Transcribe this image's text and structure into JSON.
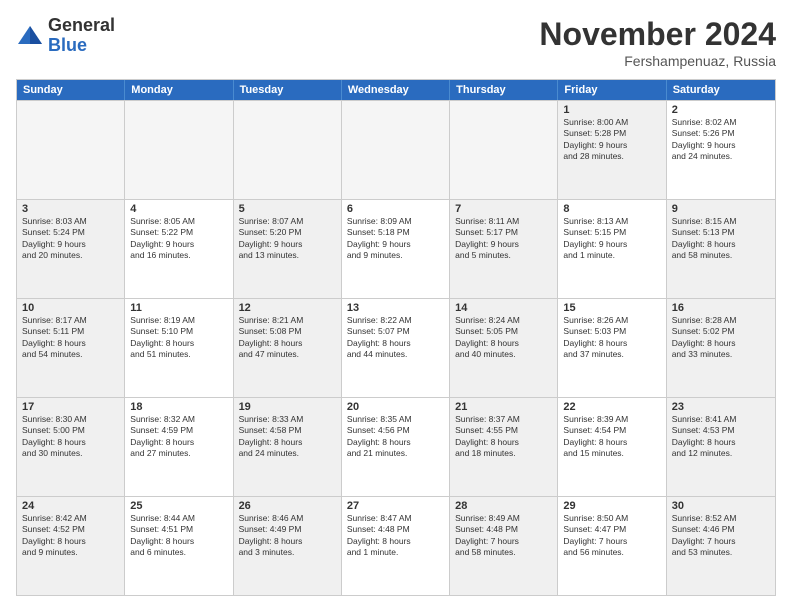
{
  "logo": {
    "general": "General",
    "blue": "Blue"
  },
  "title": "November 2024",
  "location": "Fershampenuaz, Russia",
  "header_days": [
    "Sunday",
    "Monday",
    "Tuesday",
    "Wednesday",
    "Thursday",
    "Friday",
    "Saturday"
  ],
  "rows": [
    [
      {
        "day": "",
        "info": "",
        "empty": true
      },
      {
        "day": "",
        "info": "",
        "empty": true
      },
      {
        "day": "",
        "info": "",
        "empty": true
      },
      {
        "day": "",
        "info": "",
        "empty": true
      },
      {
        "day": "",
        "info": "",
        "empty": true
      },
      {
        "day": "1",
        "info": "Sunrise: 8:00 AM\nSunset: 5:28 PM\nDaylight: 9 hours\nand 28 minutes.",
        "shaded": true
      },
      {
        "day": "2",
        "info": "Sunrise: 8:02 AM\nSunset: 5:26 PM\nDaylight: 9 hours\nand 24 minutes.",
        "shaded": false
      }
    ],
    [
      {
        "day": "3",
        "info": "Sunrise: 8:03 AM\nSunset: 5:24 PM\nDaylight: 9 hours\nand 20 minutes.",
        "shaded": true
      },
      {
        "day": "4",
        "info": "Sunrise: 8:05 AM\nSunset: 5:22 PM\nDaylight: 9 hours\nand 16 minutes.",
        "shaded": false
      },
      {
        "day": "5",
        "info": "Sunrise: 8:07 AM\nSunset: 5:20 PM\nDaylight: 9 hours\nand 13 minutes.",
        "shaded": true
      },
      {
        "day": "6",
        "info": "Sunrise: 8:09 AM\nSunset: 5:18 PM\nDaylight: 9 hours\nand 9 minutes.",
        "shaded": false
      },
      {
        "day": "7",
        "info": "Sunrise: 8:11 AM\nSunset: 5:17 PM\nDaylight: 9 hours\nand 5 minutes.",
        "shaded": true
      },
      {
        "day": "8",
        "info": "Sunrise: 8:13 AM\nSunset: 5:15 PM\nDaylight: 9 hours\nand 1 minute.",
        "shaded": false
      },
      {
        "day": "9",
        "info": "Sunrise: 8:15 AM\nSunset: 5:13 PM\nDaylight: 8 hours\nand 58 minutes.",
        "shaded": true
      }
    ],
    [
      {
        "day": "10",
        "info": "Sunrise: 8:17 AM\nSunset: 5:11 PM\nDaylight: 8 hours\nand 54 minutes.",
        "shaded": true
      },
      {
        "day": "11",
        "info": "Sunrise: 8:19 AM\nSunset: 5:10 PM\nDaylight: 8 hours\nand 51 minutes.",
        "shaded": false
      },
      {
        "day": "12",
        "info": "Sunrise: 8:21 AM\nSunset: 5:08 PM\nDaylight: 8 hours\nand 47 minutes.",
        "shaded": true
      },
      {
        "day": "13",
        "info": "Sunrise: 8:22 AM\nSunset: 5:07 PM\nDaylight: 8 hours\nand 44 minutes.",
        "shaded": false
      },
      {
        "day": "14",
        "info": "Sunrise: 8:24 AM\nSunset: 5:05 PM\nDaylight: 8 hours\nand 40 minutes.",
        "shaded": true
      },
      {
        "day": "15",
        "info": "Sunrise: 8:26 AM\nSunset: 5:03 PM\nDaylight: 8 hours\nand 37 minutes.",
        "shaded": false
      },
      {
        "day": "16",
        "info": "Sunrise: 8:28 AM\nSunset: 5:02 PM\nDaylight: 8 hours\nand 33 minutes.",
        "shaded": true
      }
    ],
    [
      {
        "day": "17",
        "info": "Sunrise: 8:30 AM\nSunset: 5:00 PM\nDaylight: 8 hours\nand 30 minutes.",
        "shaded": true
      },
      {
        "day": "18",
        "info": "Sunrise: 8:32 AM\nSunset: 4:59 PM\nDaylight: 8 hours\nand 27 minutes.",
        "shaded": false
      },
      {
        "day": "19",
        "info": "Sunrise: 8:33 AM\nSunset: 4:58 PM\nDaylight: 8 hours\nand 24 minutes.",
        "shaded": true
      },
      {
        "day": "20",
        "info": "Sunrise: 8:35 AM\nSunset: 4:56 PM\nDaylight: 8 hours\nand 21 minutes.",
        "shaded": false
      },
      {
        "day": "21",
        "info": "Sunrise: 8:37 AM\nSunset: 4:55 PM\nDaylight: 8 hours\nand 18 minutes.",
        "shaded": true
      },
      {
        "day": "22",
        "info": "Sunrise: 8:39 AM\nSunset: 4:54 PM\nDaylight: 8 hours\nand 15 minutes.",
        "shaded": false
      },
      {
        "day": "23",
        "info": "Sunrise: 8:41 AM\nSunset: 4:53 PM\nDaylight: 8 hours\nand 12 minutes.",
        "shaded": true
      }
    ],
    [
      {
        "day": "24",
        "info": "Sunrise: 8:42 AM\nSunset: 4:52 PM\nDaylight: 8 hours\nand 9 minutes.",
        "shaded": true
      },
      {
        "day": "25",
        "info": "Sunrise: 8:44 AM\nSunset: 4:51 PM\nDaylight: 8 hours\nand 6 minutes.",
        "shaded": false
      },
      {
        "day": "26",
        "info": "Sunrise: 8:46 AM\nSunset: 4:49 PM\nDaylight: 8 hours\nand 3 minutes.",
        "shaded": true
      },
      {
        "day": "27",
        "info": "Sunrise: 8:47 AM\nSunset: 4:48 PM\nDaylight: 8 hours\nand 1 minute.",
        "shaded": false
      },
      {
        "day": "28",
        "info": "Sunrise: 8:49 AM\nSunset: 4:48 PM\nDaylight: 7 hours\nand 58 minutes.",
        "shaded": true
      },
      {
        "day": "29",
        "info": "Sunrise: 8:50 AM\nSunset: 4:47 PM\nDaylight: 7 hours\nand 56 minutes.",
        "shaded": false
      },
      {
        "day": "30",
        "info": "Sunrise: 8:52 AM\nSunset: 4:46 PM\nDaylight: 7 hours\nand 53 minutes.",
        "shaded": true
      }
    ]
  ]
}
